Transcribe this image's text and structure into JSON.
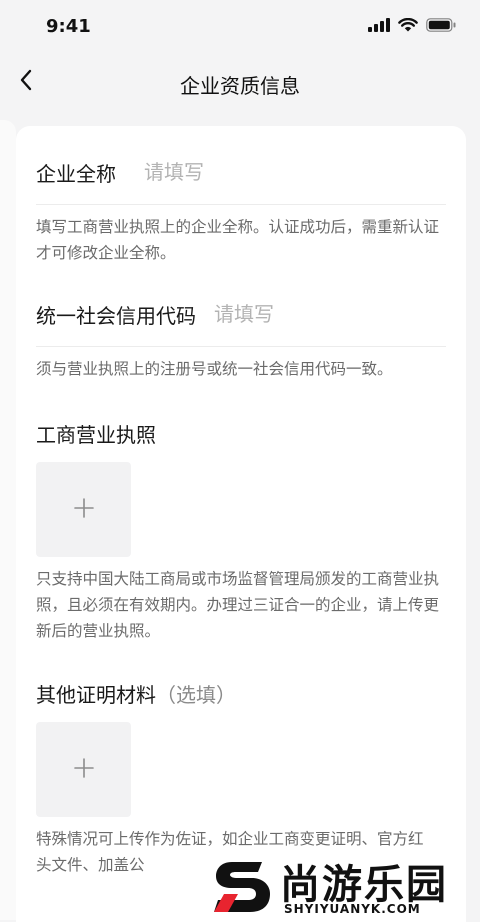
{
  "status_bar": {
    "time": "9:41"
  },
  "nav": {
    "title": "企业资质信息"
  },
  "form": {
    "company_name": {
      "label": "企业全称",
      "placeholder": "请填写",
      "help": "填写工商营业执照上的企业全称。认证成功后，需重新认证才可修改企业全称。"
    },
    "credit_code": {
      "label": "统一社会信用代码",
      "placeholder": "请填写",
      "help": "须与营业执照上的注册号或统一社会信用代码一致。"
    },
    "license": {
      "title": "工商营业执照",
      "help": "只支持中国大陆工商局或市场监督管理局颁发的工商营业执照，且必须在有效期内。办理过三证合一的企业，请上传更新后的营业执照。"
    },
    "other_materials": {
      "title": "其他证明材料",
      "optional": "（选填）",
      "help": "特殊情况可上传作为佐证，如企业工商变更证明、官方红头文件、加盖公"
    }
  },
  "watermark": {
    "name": "尚游乐园",
    "url": "SHYIYUANYK.COM",
    "accent": "#e8242f"
  }
}
